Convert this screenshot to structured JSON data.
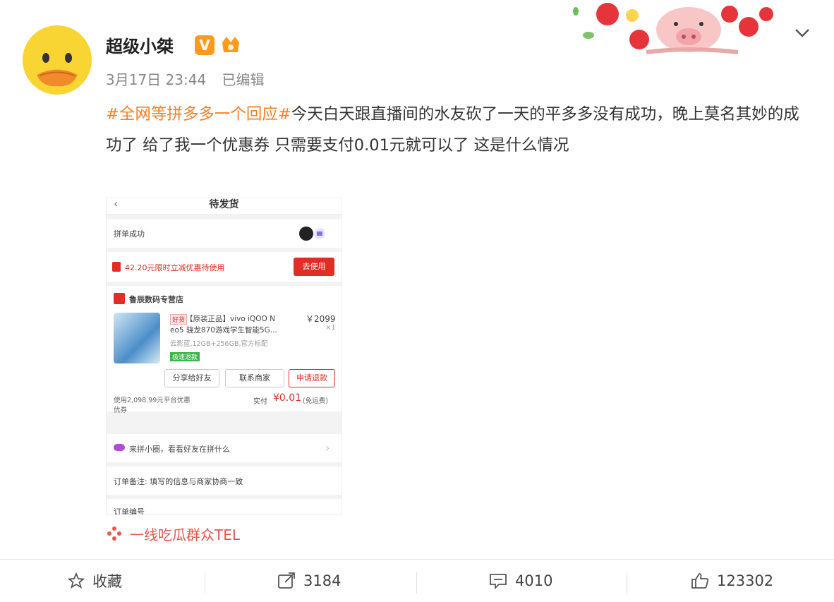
{
  "post": {
    "author": "超级小桀",
    "date": "3月17日 23:44",
    "edited": "已编辑",
    "hashtag": "#全网等拼多多一个回应#",
    "body": "今天白天跟直播间的水友砍了一天的平多多没有成功，晚上莫名其妙的成功了 给了我一个优惠券 只需要支付0.01元就可以了 这是什么情况",
    "colors": {
      "hashtag": "#ff7d22",
      "badge": "#ff9a1f",
      "watermark": "#e8564e"
    }
  },
  "embedded": {
    "title": "待发货",
    "group_status": "拼单成功",
    "coupon": "42.20元限时立减优惠待使用",
    "use_button": "去使用",
    "shop": "鲁辰数码专营店",
    "product_tag": "好货",
    "product_name_1": "【原装正品】vivo iQOO N",
    "product_name_2": "eo5 骁龙870游戏学生智能5G...",
    "product_spec": "云影蓝,12GB+256GB,官方标配",
    "product_price": "￥2099",
    "product_qty": "×1",
    "green_tag": "极速退款",
    "btn_share": "分享给好友",
    "btn_contact": "联系商家",
    "btn_refund": "申请退款",
    "discount_note_1": "使用2,098.99元平台优惠",
    "discount_note_2": "优券",
    "paid_label": "实付",
    "paid_amount": "¥0.01",
    "paid_note": "(免运费)",
    "group_row": "来拼小圈，看看好友在拼什么",
    "remark": "订单备注: 填写的信息与商家协商一致",
    "bottom_cut": "订单编号"
  },
  "watermark": "一线吃瓜群众TEL",
  "actions": {
    "favorite": "收藏",
    "repost": "3184",
    "comment": "4010",
    "like": "123302"
  }
}
